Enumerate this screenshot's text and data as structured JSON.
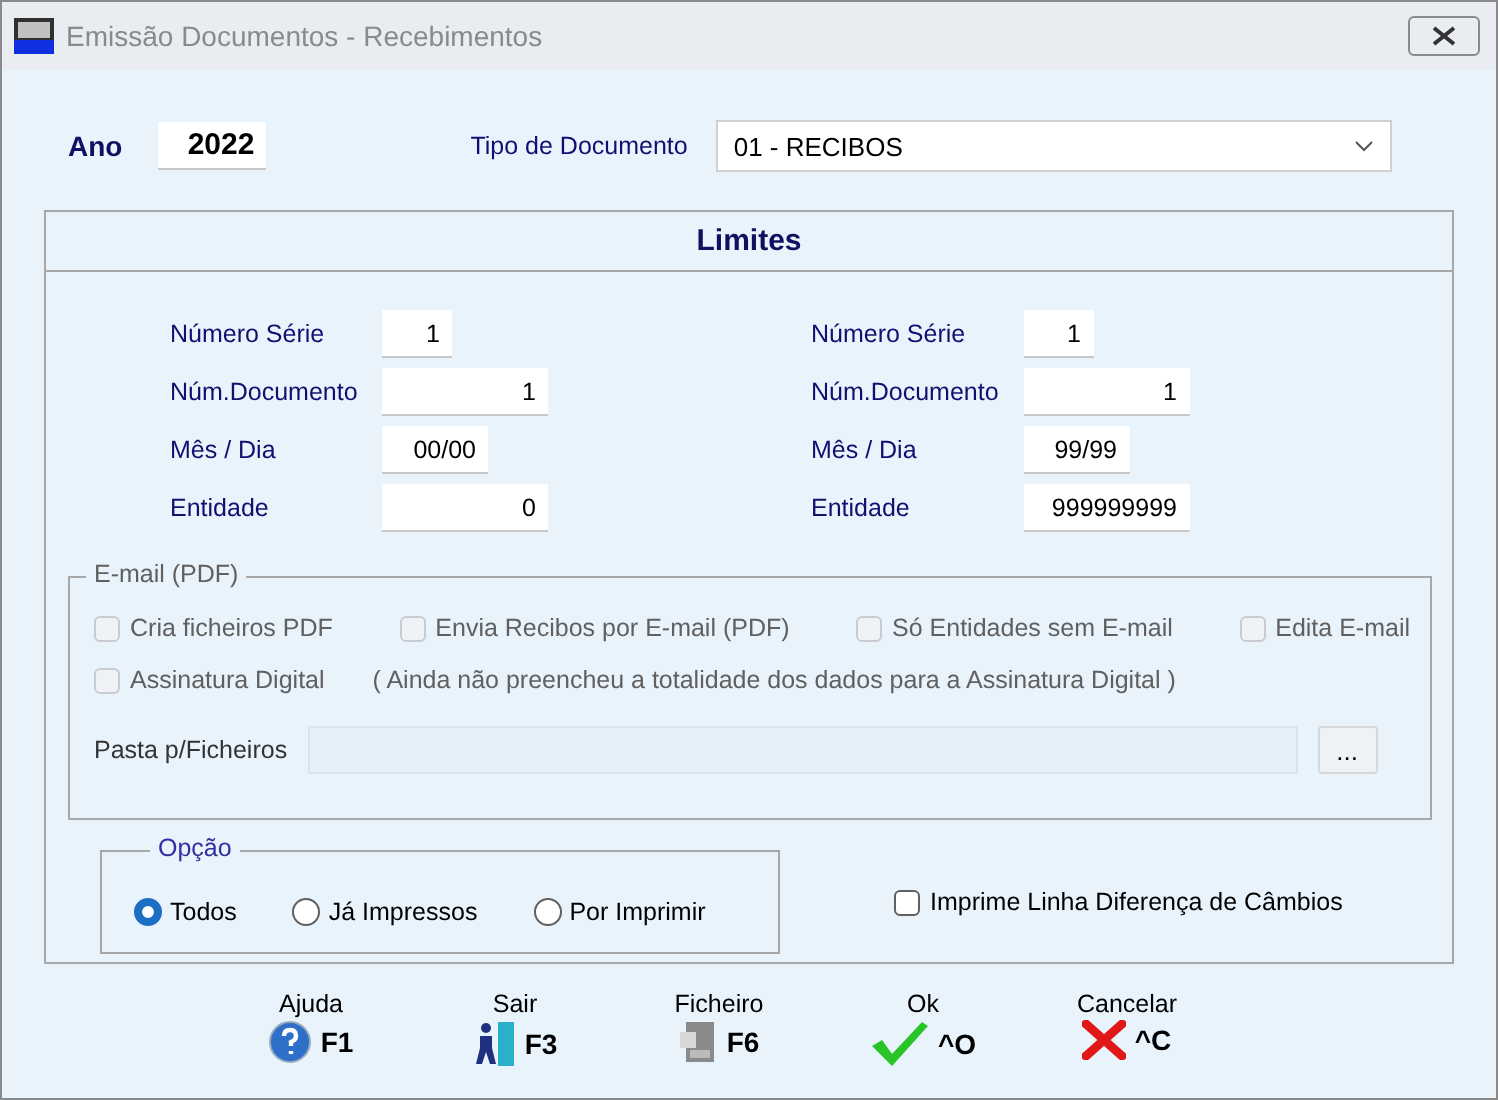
{
  "window": {
    "title": "Emissão Documentos - Recebimentos"
  },
  "ano": {
    "label": "Ano",
    "value": "2022"
  },
  "tipo_documento": {
    "label": "Tipo de Documento",
    "value": "01 - RECIBOS"
  },
  "limites": {
    "title": "Limites",
    "from": [
      {
        "label": "Número Série",
        "value": "1"
      },
      {
        "label": "Núm.Documento",
        "value": "1"
      },
      {
        "label": "Mês / Dia",
        "value": "00/00"
      },
      {
        "label": "Entidade",
        "value": "0"
      }
    ],
    "to": [
      {
        "label": "Número Série",
        "value": "1"
      },
      {
        "label": "Núm.Documento",
        "value": "1"
      },
      {
        "label": "Mês / Dia",
        "value": "99/99"
      },
      {
        "label": "Entidade",
        "value": "999999999"
      }
    ]
  },
  "email": {
    "title": "E-mail (PDF)",
    "options": [
      {
        "label": "Cria ficheiros PDF",
        "checked": false,
        "disabled": true
      },
      {
        "label": "Envia Recibos por E-mail (PDF)",
        "checked": false,
        "disabled": true
      },
      {
        "label": "Só Entidades sem E-mail",
        "checked": false,
        "disabled": true
      },
      {
        "label": "Edita E-mail",
        "checked": false,
        "disabled": true
      },
      {
        "label": "Assinatura Digital",
        "checked": false,
        "disabled": true
      }
    ],
    "note": "( Ainda não preencheu a totalidade dos dados para a Assinatura Digital )",
    "folder": {
      "label": "Pasta p/Ficheiros",
      "disabled": true
    },
    "browse": "..."
  },
  "opcao": {
    "title": "Opção",
    "options": [
      {
        "label": "Todos",
        "selected": true
      },
      {
        "label": "Já Impressos",
        "selected": false
      },
      {
        "label": "Por Imprimir",
        "selected": false
      }
    ]
  },
  "diferenca_cambios": {
    "label": "Imprime Linha Diferença de Câmbios",
    "checked": false
  },
  "toolbar": [
    {
      "label": "Ajuda",
      "key": "F1",
      "kind": "help"
    },
    {
      "label": "Sair",
      "key": "F3",
      "kind": "exit"
    },
    {
      "label": "Ficheiro",
      "key": "F6",
      "kind": "file"
    },
    {
      "label": "Ok",
      "key": "^O",
      "kind": "ok"
    },
    {
      "label": "Cancelar",
      "key": "^C",
      "kind": "cancel"
    }
  ]
}
